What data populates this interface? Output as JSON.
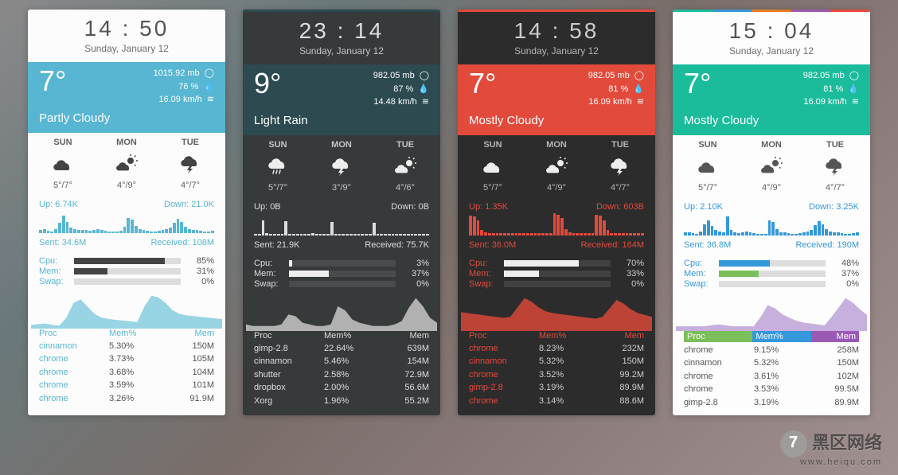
{
  "labels": {
    "up": "Up:",
    "down": "Down:",
    "sent": "Sent:",
    "recv": "Received:",
    "cpu": "Cpu:",
    "mem": "Mem:",
    "swap": "Swap:",
    "proc": "Proc",
    "mempct": "Mem%",
    "memcol": "Mem"
  },
  "widgets": [
    {
      "theme": "w0",
      "accent": "#57b6d2",
      "time": "14 : 50",
      "date": "Sunday, January 12",
      "temp": "7°",
      "press": "1015.92 mb",
      "hum": "76 %",
      "wind": "16.09 km/h",
      "cond": "Partly Cloudy",
      "wh_bg": "#57b6d2",
      "fc": [
        {
          "d": "SUN",
          "i": "cloud",
          "r": "5°/7°"
        },
        {
          "d": "MON",
          "i": "partly",
          "r": "4°/9°"
        },
        {
          "d": "TUE",
          "i": "storm",
          "r": "4°/7°"
        }
      ],
      "fc_ico": "#444",
      "net": {
        "up": "6.74K",
        "down": "21.0K",
        "sent": "34.6M",
        "recv": "108M",
        "lab": "#57b6d2",
        "g": [
          5,
          7,
          4,
          3,
          8,
          20,
          35,
          22,
          10,
          8,
          6,
          6,
          5,
          4,
          6,
          8,
          6,
          4,
          3,
          2,
          3,
          4,
          12,
          30,
          26,
          14,
          8,
          5,
          4,
          3,
          3,
          4,
          6,
          8,
          10,
          20,
          28,
          22,
          12,
          8,
          6,
          5,
          4,
          3,
          3,
          4
        ]
      },
      "sys": {
        "lab": "#57b6d2",
        "bar": "#444",
        "cpu": 85,
        "mem": 31,
        "swap": 0
      },
      "area": {
        "fill": "#7fc9dd",
        "pts": [
          10,
          12,
          14,
          10,
          8,
          30,
          70,
          80,
          60,
          40,
          30,
          26,
          24,
          22,
          20,
          18,
          60,
          90,
          85,
          70,
          50,
          40,
          36,
          34,
          32,
          30,
          28,
          26
        ]
      },
      "ptab": {
        "hdr": "#57b6d2",
        "name": "#57b6d2",
        "rows": [
          [
            "cinnamon",
            "5.30%",
            "150M"
          ],
          [
            "chrome",
            "3.73%",
            "105M"
          ],
          [
            "chrome",
            "3.68%",
            "104M"
          ],
          [
            "chrome",
            "3.59%",
            "101M"
          ],
          [
            "chrome",
            "3.26%",
            "91.9M"
          ]
        ]
      }
    },
    {
      "theme": "w1",
      "accent": "#e8e8e8",
      "time": "23 : 14",
      "date": "Sunday, January 12",
      "temp": "9°",
      "press": "982.05 mb",
      "hum": "87 %",
      "wind": "14.48 km/h",
      "cond": "Light Rain",
      "wh_bg": "#2c4a50",
      "acc_strip": [
        "#2c4a50",
        "#2c4a50",
        "#2c4a50"
      ],
      "fc": [
        {
          "d": "SUN",
          "i": "rain",
          "r": "5°/7°"
        },
        {
          "d": "MON",
          "i": "storm",
          "r": "3°/9°"
        },
        {
          "d": "TUE",
          "i": "partly",
          "r": "4°/6°"
        }
      ],
      "fc_ico": "#eee",
      "net": {
        "up": "0B",
        "down": "0B",
        "sent": "21.9K",
        "recv": "75.7K",
        "lab": "#ddd",
        "g": [
          2,
          2,
          30,
          4,
          2,
          2,
          2,
          3,
          28,
          3,
          2,
          2,
          2,
          2,
          3,
          4,
          3,
          2,
          2,
          2,
          26,
          3,
          2,
          2,
          2,
          2,
          2,
          3,
          2,
          2,
          2,
          25,
          3,
          2,
          2,
          2,
          2,
          2,
          2,
          2,
          2,
          2,
          2,
          2,
          2,
          2
        ]
      },
      "sys": {
        "lab": "#ddd",
        "bar": "#eee",
        "cpu": 3,
        "mem": 37,
        "swap": 0
      },
      "area": {
        "fill": "#cfcfcf",
        "pts": [
          8,
          6,
          6,
          6,
          6,
          8,
          20,
          18,
          10,
          8,
          6,
          6,
          8,
          30,
          25,
          14,
          10,
          8,
          6,
          6,
          6,
          8,
          12,
          28,
          40,
          30,
          16,
          10
        ]
      },
      "ptab": {
        "hdr": "#ddd",
        "name": "#ddd",
        "rows": [
          [
            "gimp-2.8",
            "22.64%",
            "639M"
          ],
          [
            "cinnamon",
            "5.46%",
            "154M"
          ],
          [
            "shutter",
            "2.58%",
            "72.9M"
          ],
          [
            "dropbox",
            "2.00%",
            "56.6M"
          ],
          [
            "Xorg",
            "1.96%",
            "55.2M"
          ]
        ]
      }
    },
    {
      "theme": "w2",
      "accent": "#e24a3b",
      "time": "14 : 58",
      "date": "Sunday, January 12",
      "temp": "7°",
      "press": "982.05 mb",
      "hum": "81 %",
      "wind": "16.09 km/h",
      "cond": "Mostly Cloudy",
      "wh_bg": "#e24a3b",
      "acc_strip": [
        "#e24a3b",
        "#e24a3b",
        "#e24a3b"
      ],
      "fc": [
        {
          "d": "SUN",
          "i": "cloud",
          "r": "5°/7°"
        },
        {
          "d": "MON",
          "i": "partly",
          "r": "4°/9°"
        },
        {
          "d": "TUE",
          "i": "storm",
          "r": "4°/7°"
        }
      ],
      "fc_ico": "#eee",
      "net": {
        "up": "1.35K",
        "down": "603B",
        "sent": "36.0M",
        "recv": "164M",
        "lab": "#e24a3b",
        "g": [
          40,
          38,
          30,
          10,
          6,
          4,
          4,
          4,
          4,
          4,
          4,
          4,
          4,
          4,
          4,
          4,
          4,
          4,
          4,
          4,
          4,
          4,
          45,
          42,
          35,
          12,
          6,
          4,
          4,
          4,
          4,
          4,
          4,
          42,
          40,
          30,
          10,
          4,
          4,
          4,
          4,
          4,
          4,
          4,
          4,
          4
        ]
      },
      "sys": {
        "lab": "#e24a3b",
        "bar": "#eee",
        "cpu": 70,
        "mem": 33,
        "swap": 0
      },
      "area": {
        "fill": "#e24a3b",
        "pts": [
          40,
          38,
          36,
          34,
          32,
          30,
          28,
          30,
          50,
          70,
          62,
          50,
          42,
          38,
          36,
          34,
          32,
          30,
          28,
          26,
          30,
          48,
          66,
          58,
          46,
          38,
          34,
          30
        ]
      },
      "ptab": {
        "hdr": "#e24a3b",
        "name": "#e24a3b",
        "rows": [
          [
            "chrome",
            "8.23%",
            "232M"
          ],
          [
            "cinnamon",
            "5.32%",
            "150M"
          ],
          [
            "chrome",
            "3.52%",
            "99.2M"
          ],
          [
            "gimp-2.8",
            "3.19%",
            "89.9M"
          ],
          [
            "chrome",
            "3.14%",
            "88.6M"
          ]
        ]
      }
    },
    {
      "theme": "w3",
      "accent": "#1abc9c",
      "time": "15 : 04",
      "date": "Sunday, January 12",
      "temp": "7°",
      "press": "982.05 mb",
      "hum": "81 %",
      "wind": "16.09 km/h",
      "cond": "Mostly Cloudy",
      "wh_bg": "#1abc9c",
      "acc_strip": [
        "#1abc9c",
        "#3498db",
        "#e67e22",
        "#9b59b6",
        "#e74c3c"
      ],
      "fc": [
        {
          "d": "SUN",
          "i": "cloud",
          "r": "5°/7°"
        },
        {
          "d": "MON",
          "i": "partly",
          "r": "4°/9°"
        },
        {
          "d": "TUE",
          "i": "storm",
          "r": "4°/7°"
        }
      ],
      "fc_ico": "#555",
      "net": {
        "up": "2.10K",
        "down": "3.25K",
        "sent": "36.8M",
        "recv": "190M",
        "lab": "#3498db",
        "g": [
          6,
          5,
          4,
          3,
          8,
          22,
          30,
          18,
          10,
          8,
          6,
          38,
          10,
          5,
          4,
          6,
          8,
          6,
          4,
          3,
          2,
          3,
          30,
          26,
          12,
          6,
          5,
          4,
          3,
          3,
          4,
          6,
          8,
          10,
          20,
          28,
          22,
          12,
          8,
          6,
          5,
          4,
          3,
          3,
          4,
          6
        ]
      },
      "sys": {
        "lab": "#3498db",
        "bar_cpu": "#3498db",
        "bar_mem": "#7bbf5a",
        "bar_swap": "#9b59b6",
        "cpu": 48,
        "mem": 37,
        "swap": 0
      },
      "area": {
        "fill": "#b99bd6",
        "pts": [
          10,
          10,
          10,
          10,
          10,
          12,
          14,
          12,
          10,
          10,
          10,
          10,
          30,
          55,
          48,
          36,
          28,
          22,
          18,
          16,
          14,
          12,
          30,
          50,
          70,
          60,
          46,
          34
        ]
      },
      "ptab": {
        "hdr_bg": [
          "#7bbf5a",
          "#3498db",
          "#9b59b6"
        ],
        "name": "#555",
        "rows": [
          [
            "chrome",
            "9.15%",
            "258M"
          ],
          [
            "cinnamon",
            "5.32%",
            "150M"
          ],
          [
            "chrome",
            "3.61%",
            "102M"
          ],
          [
            "chrome",
            "3.53%",
            "99.5M"
          ],
          [
            "gimp-2.8",
            "3.19%",
            "89.9M"
          ]
        ]
      }
    }
  ],
  "watermark": {
    "main": "黑区网络",
    "sub": "www.heiqu.com"
  }
}
